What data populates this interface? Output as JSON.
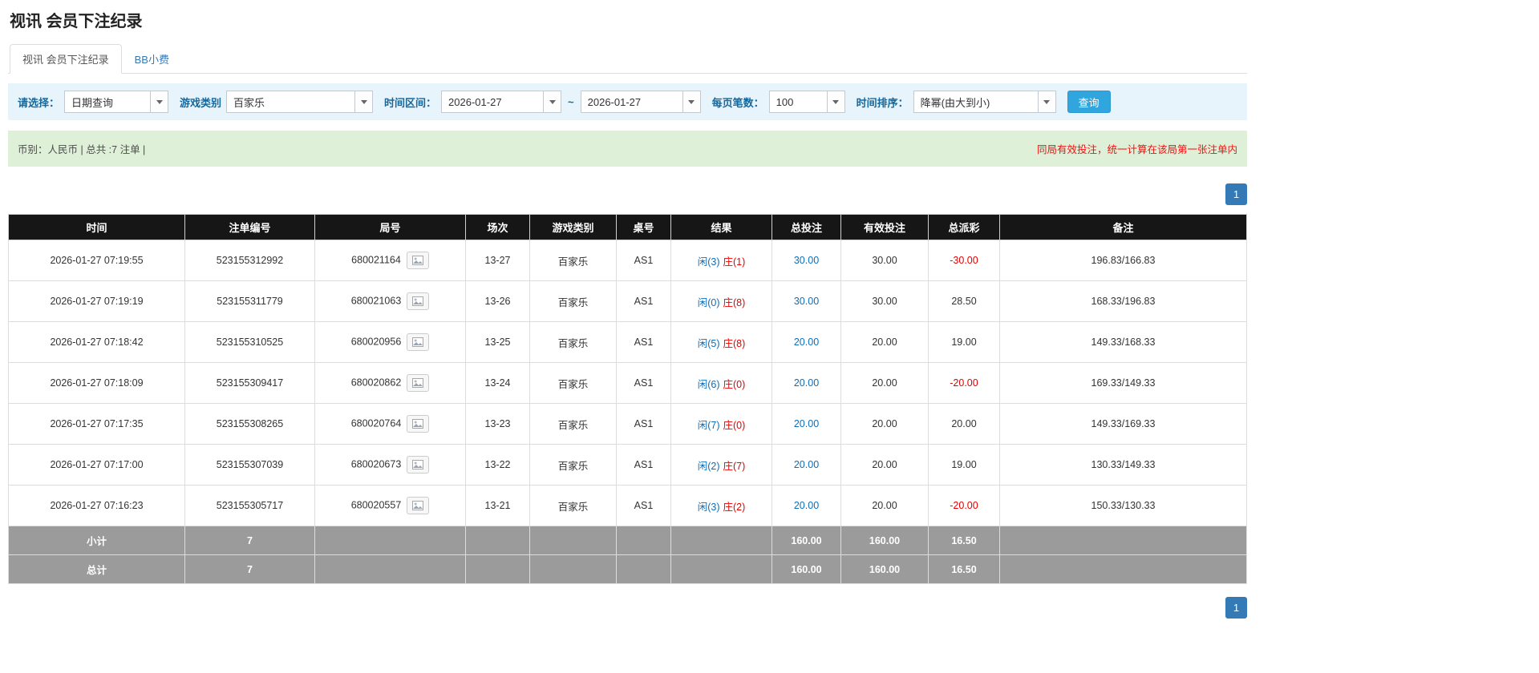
{
  "page": {
    "title": "视讯 会员下注纪录"
  },
  "tabs": [
    {
      "label": "视讯 会员下注纪录",
      "active": true
    },
    {
      "label": "BB小费",
      "active": false
    }
  ],
  "filters": {
    "select_label": "请选择：",
    "select_value": "日期查询",
    "game_type_label": "游戏类别",
    "game_type_value": "百家乐",
    "date_range_label": "时间区间：",
    "date_from": "2026-01-27",
    "date_separator": "~",
    "date_to": "2026-01-27",
    "page_size_label": "每页笔数：",
    "page_size_value": "100",
    "sort_label": "时间排序：",
    "sort_value": "降幂(由大到小)",
    "search_button": "查询"
  },
  "summary": {
    "left": "币别：人民币 | 总共 :7 注单 |",
    "right": "同局有效投注，统一计算在该局第一张注单内"
  },
  "pagination": {
    "page": "1"
  },
  "table": {
    "headers": [
      "时间",
      "注单编号",
      "局号",
      "场次",
      "游戏类别",
      "桌号",
      "结果",
      "总投注",
      "有效投注",
      "总派彩",
      "备注"
    ],
    "rows": [
      {
        "time": "2026-01-27 07:19:55",
        "bet_id": "523155312992",
        "round": "680021164",
        "session": "13-27",
        "game": "百家乐",
        "table_no": "AS1",
        "result_player": "闲(3)",
        "result_banker": "庄(1)",
        "total_bet": "30.00",
        "valid_bet": "30.00",
        "payout": "-30.00",
        "remark": "196.83/166.83"
      },
      {
        "time": "2026-01-27 07:19:19",
        "bet_id": "523155311779",
        "round": "680021063",
        "session": "13-26",
        "game": "百家乐",
        "table_no": "AS1",
        "result_player": "闲(0)",
        "result_banker": "庄(8)",
        "total_bet": "30.00",
        "valid_bet": "30.00",
        "payout": "28.50",
        "remark": "168.33/196.83"
      },
      {
        "time": "2026-01-27 07:18:42",
        "bet_id": "523155310525",
        "round": "680020956",
        "session": "13-25",
        "game": "百家乐",
        "table_no": "AS1",
        "result_player": "闲(5)",
        "result_banker": "庄(8)",
        "total_bet": "20.00",
        "valid_bet": "20.00",
        "payout": "19.00",
        "remark": "149.33/168.33"
      },
      {
        "time": "2026-01-27 07:18:09",
        "bet_id": "523155309417",
        "round": "680020862",
        "session": "13-24",
        "game": "百家乐",
        "table_no": "AS1",
        "result_player": "闲(6)",
        "result_banker": "庄(0)",
        "total_bet": "20.00",
        "valid_bet": "20.00",
        "payout": "-20.00",
        "remark": "169.33/149.33"
      },
      {
        "time": "2026-01-27 07:17:35",
        "bet_id": "523155308265",
        "round": "680020764",
        "session": "13-23",
        "game": "百家乐",
        "table_no": "AS1",
        "result_player": "闲(7)",
        "result_banker": "庄(0)",
        "total_bet": "20.00",
        "valid_bet": "20.00",
        "payout": "20.00",
        "remark": "149.33/169.33"
      },
      {
        "time": "2026-01-27 07:17:00",
        "bet_id": "523155307039",
        "round": "680020673",
        "session": "13-22",
        "game": "百家乐",
        "table_no": "AS1",
        "result_player": "闲(2)",
        "result_banker": "庄(7)",
        "total_bet": "20.00",
        "valid_bet": "20.00",
        "payout": "19.00",
        "remark": "130.33/149.33"
      },
      {
        "time": "2026-01-27 07:16:23",
        "bet_id": "523155305717",
        "round": "680020557",
        "session": "13-21",
        "game": "百家乐",
        "table_no": "AS1",
        "result_player": "闲(3)",
        "result_banker": "庄(2)",
        "total_bet": "20.00",
        "valid_bet": "20.00",
        "payout": "-20.00",
        "remark": "150.33/130.33"
      }
    ],
    "subtotal": {
      "label": "小计",
      "count": "7",
      "total_bet": "160.00",
      "valid_bet": "160.00",
      "payout": "16.50"
    },
    "total": {
      "label": "总计",
      "count": "7",
      "total_bet": "160.00",
      "valid_bet": "160.00",
      "payout": "16.50"
    }
  }
}
